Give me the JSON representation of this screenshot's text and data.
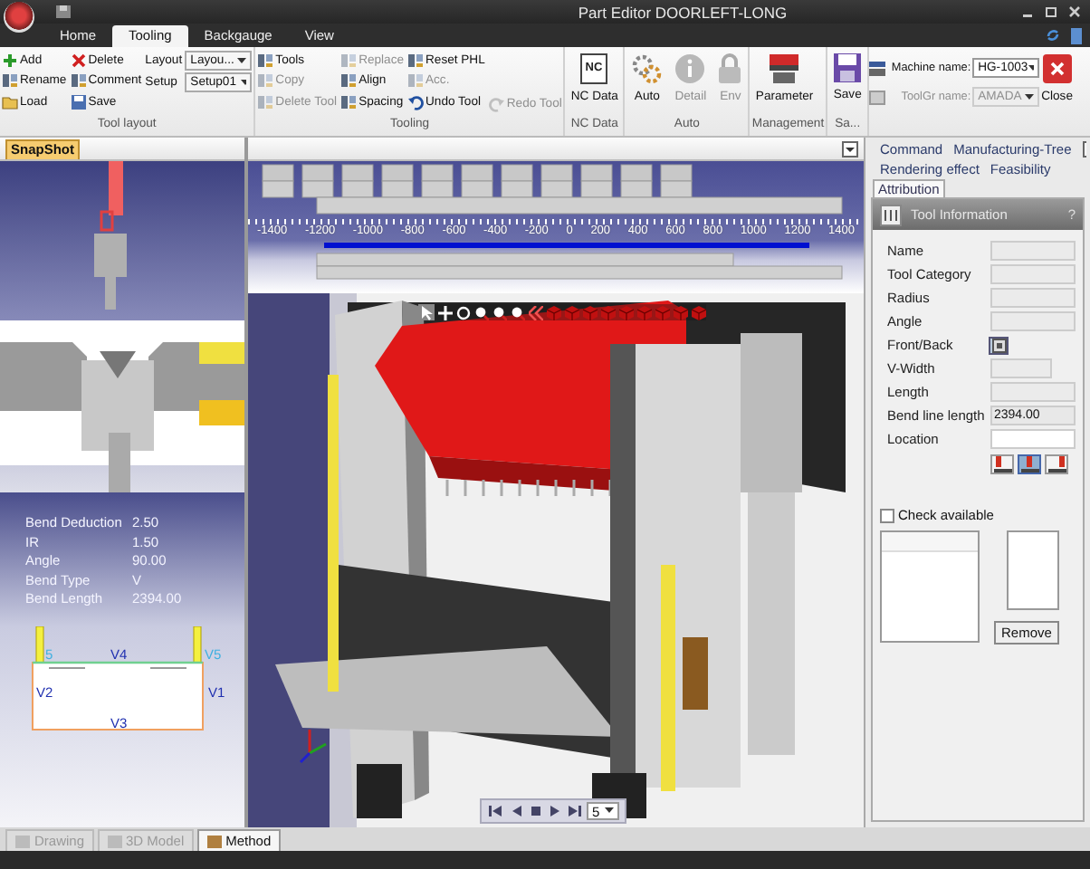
{
  "window": {
    "title": "Part Editor  DOORLEFT-LONG"
  },
  "ribbon_tabs": [
    {
      "label": "Home",
      "selected": false
    },
    {
      "label": "Tooling",
      "selected": true
    },
    {
      "label": "Backgauge",
      "selected": false
    },
    {
      "label": "View",
      "selected": false
    }
  ],
  "ribbon_groups": [
    {
      "label": "Tool layout",
      "columns": [
        [
          {
            "kind": "small",
            "label": "Add",
            "disabled": false
          },
          {
            "kind": "small",
            "label": "Rename",
            "disabled": false
          },
          {
            "kind": "small",
            "label": "Load",
            "disabled": false
          }
        ],
        [
          {
            "kind": "small",
            "label": "Delete",
            "disabled": false
          },
          {
            "kind": "small",
            "label": "Comment",
            "disabled": false
          },
          {
            "kind": "small",
            "label": "Save",
            "disabled": false
          }
        ],
        [
          {
            "kind": "select",
            "label": "Layout",
            "value": "Layou..."
          },
          {
            "kind": "select",
            "label": "Setup",
            "value": "Setup01"
          }
        ]
      ]
    },
    {
      "label": "Tooling",
      "columns": [
        [
          {
            "kind": "small",
            "label": "Tools",
            "disabled": false
          },
          {
            "kind": "small",
            "label": "Copy",
            "disabled": true
          },
          {
            "kind": "small",
            "label": "Delete Tool",
            "disabled": true
          }
        ],
        [
          {
            "kind": "small",
            "label": "Replace",
            "disabled": true
          },
          {
            "kind": "small",
            "label": "Align",
            "disabled": false
          },
          {
            "kind": "small",
            "label": "Spacing",
            "disabled": false
          }
        ],
        [
          {
            "kind": "small",
            "label": "Reset PHL",
            "disabled": false
          },
          {
            "kind": "small",
            "label": "Acc.",
            "disabled": true
          },
          {
            "kind": "small",
            "label": "Undo Tool",
            "disabled": false
          }
        ],
        [
          {
            "kind": "spacer"
          },
          {
            "kind": "spacer"
          },
          {
            "kind": "small",
            "label": "Redo Tool",
            "disabled": true
          }
        ]
      ]
    },
    {
      "label": "NC Data",
      "columns": [
        [
          {
            "kind": "large",
            "icon_text": "NC",
            "label": "NC Data",
            "disabled": false
          }
        ]
      ]
    },
    {
      "label": "Auto",
      "columns": [
        [
          {
            "kind": "large",
            "label": "Auto",
            "disabled": false
          }
        ],
        [
          {
            "kind": "large",
            "label": "Detail",
            "disabled": true
          }
        ],
        [
          {
            "kind": "large",
            "label": "Env",
            "disabled": true
          }
        ]
      ]
    },
    {
      "label": "Management",
      "columns": [
        [
          {
            "kind": "large",
            "label": "Parameter",
            "disabled": false
          }
        ]
      ]
    },
    {
      "label": "Sa...",
      "columns": [
        [
          {
            "kind": "large",
            "label": "Save",
            "disabled": false
          }
        ]
      ]
    }
  ],
  "machine_fields": [
    {
      "label": "Machine name:",
      "value": "HG-1003",
      "disabled": false
    },
    {
      "label": "ToolGr name:",
      "value": "AMADA",
      "disabled": true
    }
  ],
  "close_button": {
    "label": "Close"
  },
  "snapshot": {
    "tab": "SnapShot",
    "bend_info": [
      {
        "label": "Bend Deduction",
        "value": "2.50"
      },
      {
        "label": "IR",
        "value": "1.50"
      },
      {
        "label": "Angle",
        "value": "90.00"
      },
      {
        "label": "Bend Type",
        "value": "V"
      },
      {
        "label": "Bend Length",
        "value": "2394.00"
      }
    ],
    "diagram_labels": [
      "5",
      "V4",
      "V5",
      "V2",
      "V1",
      "V3"
    ]
  },
  "ruler": {
    "ticks": [
      "-1400",
      "-1200",
      "-1000",
      "-800",
      "-600",
      "-400",
      "-200",
      "0",
      "200",
      "400",
      "600",
      "800",
      "1000",
      "1200",
      "1400"
    ]
  },
  "view_toolbar": [
    {
      "kind": "pointer",
      "selected": true
    },
    {
      "kind": "move",
      "selected": false
    },
    {
      "kind": "rotate",
      "selected": false
    },
    {
      "kind": "zoom",
      "selected": false
    },
    {
      "kind": "zoom",
      "selected": false
    },
    {
      "kind": "zoom",
      "selected": false
    },
    {
      "kind": "rewind",
      "selected": false
    },
    {
      "kind": "cube",
      "selected": false
    },
    {
      "kind": "cube",
      "selected": false
    },
    {
      "kind": "cube",
      "selected": false
    },
    {
      "kind": "cube",
      "selected": false
    },
    {
      "kind": "cube",
      "selected": false
    },
    {
      "kind": "cube",
      "selected": false
    },
    {
      "kind": "cube",
      "selected": false
    },
    {
      "kind": "cube",
      "selected": false
    },
    {
      "kind": "cube",
      "selected": false
    }
  ],
  "player": {
    "buttons": [
      {
        "kind": "first"
      },
      {
        "kind": "prev"
      },
      {
        "kind": "stop"
      },
      {
        "kind": "play"
      },
      {
        "kind": "last"
      }
    ],
    "step": "5"
  },
  "right_tabs": [
    {
      "label": "Command",
      "selected": false
    },
    {
      "label": "Manufacturing-Tree",
      "selected": false
    },
    {
      "label": "Rendering effect",
      "selected": false
    },
    {
      "label": "Feasibility",
      "selected": false
    },
    {
      "label": "Attribution",
      "selected": true
    }
  ],
  "tool_info": {
    "title": "Tool Information",
    "help": "?",
    "fields": [
      {
        "kind": "input",
        "label": "Name"
      },
      {
        "kind": "input",
        "label": "Tool Category"
      },
      {
        "kind": "input",
        "label": "Radius"
      },
      {
        "kind": "input",
        "label": "Angle"
      },
      {
        "kind": "toggle",
        "label": "Front/Back"
      },
      {
        "kind": "short",
        "label": "V-Width"
      },
      {
        "kind": "input",
        "label": "Length"
      },
      {
        "kind": "readonly",
        "label": "Bend line length",
        "value": "2394.00"
      },
      {
        "kind": "editable",
        "label": "Location"
      }
    ],
    "location_buttons": [
      {
        "selected": false
      },
      {
        "selected": true
      },
      {
        "selected": false
      }
    ],
    "check_available": {
      "label": "Check available",
      "checked": false
    },
    "remove_button": "Remove"
  },
  "bottom_tabs": [
    {
      "label": "Drawing",
      "selected": false,
      "disabled": true
    },
    {
      "label": "3D Model",
      "selected": false,
      "disabled": true
    },
    {
      "label": "Method",
      "selected": true,
      "disabled": false
    }
  ]
}
